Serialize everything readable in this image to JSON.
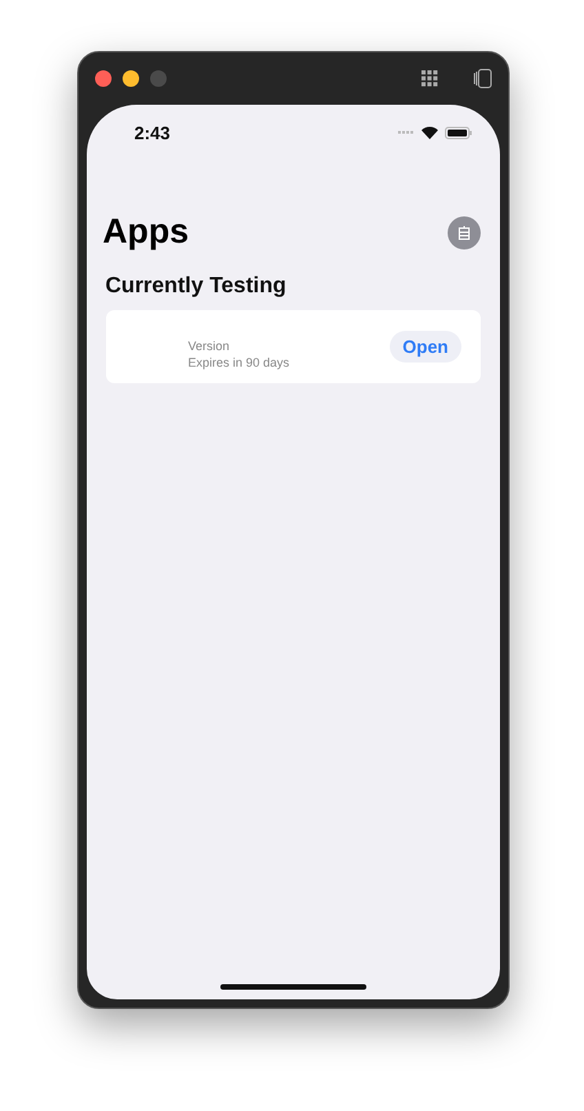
{
  "status_bar": {
    "time": "2:43"
  },
  "title": "Apps",
  "section": {
    "title": "Currently Testing"
  },
  "apps": [
    {
      "version": "Version",
      "expiry": "Expires in 90 days",
      "action": "Open"
    }
  ]
}
